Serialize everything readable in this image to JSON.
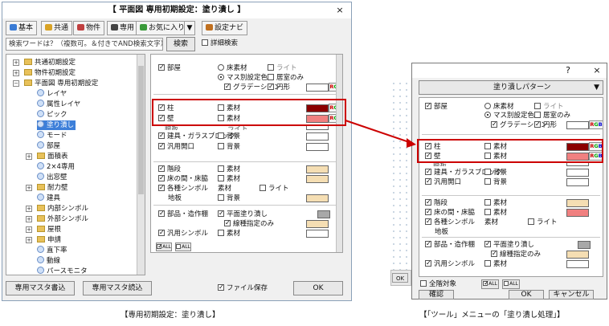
{
  "main": {
    "title": "【 平面図 専用初期設定：塗り潰し 】",
    "close_glyph": "×",
    "tabs": [
      "基本",
      "共通",
      "物件",
      "専用",
      "お気に入り",
      "▼"
    ],
    "tab_icon_colors": [
      "#3a7bd5",
      "#d9a326",
      "#c04040",
      "#444444",
      "#3a9a3a"
    ],
    "navi_label": "設定ナビ",
    "search_placeholder": "検索ワードは？（複数可。＆付きでAND検索文字）",
    "search_button": "検索",
    "detail_search_label": "詳細検索",
    "tree": [
      {
        "label": "共通初期設定",
        "kind": "folder",
        "expander": "+"
      },
      {
        "label": "物件初期設定",
        "kind": "folder",
        "expander": "+"
      },
      {
        "label": "平面図 専用初期設定",
        "kind": "folder",
        "expander": "−"
      },
      {
        "label": "レイヤ",
        "kind": "leaf"
      },
      {
        "label": "属性レイヤ",
        "kind": "leaf"
      },
      {
        "label": "ピック",
        "kind": "leaf"
      },
      {
        "label": "塗り潰し",
        "kind": "leaf",
        "selected": true
      },
      {
        "label": "モード",
        "kind": "leaf"
      },
      {
        "label": "部屋",
        "kind": "leaf"
      },
      {
        "label": "面積表",
        "kind": "folder",
        "expander": "+"
      },
      {
        "label": "2×4専用",
        "kind": "leaf"
      },
      {
        "label": "出窓壁",
        "kind": "leaf"
      },
      {
        "label": "耐力壁",
        "kind": "folder",
        "expander": "+"
      },
      {
        "label": "建具",
        "kind": "leaf"
      },
      {
        "label": "内部シンボル",
        "kind": "folder",
        "expander": "+"
      },
      {
        "label": "外部シンボル",
        "kind": "folder",
        "expander": "+"
      },
      {
        "label": "屋根",
        "kind": "folder",
        "expander": "+"
      },
      {
        "label": "申請",
        "kind": "folder",
        "expander": "+"
      },
      {
        "label": "直下率",
        "kind": "leaf"
      },
      {
        "label": "動線",
        "kind": "leaf"
      },
      {
        "label": "パースモニタ",
        "kind": "leaf"
      }
    ],
    "buttons": {
      "write": "専用マスタ書込",
      "read": "専用マスタ読込",
      "ok": "OK"
    },
    "file_save_label": "ファイル保存"
  },
  "panel": {
    "room": {
      "label": "部屋",
      "floor_material": "床素材",
      "light": "ライト",
      "mass_color": "マス別設定色",
      "living_only": "居室のみ",
      "gradation": "グラデーション",
      "circle": "円形"
    },
    "pillar": "柱",
    "wall": "壁",
    "material": "素材",
    "background": "背景",
    "cut_label": "腰板",
    "fitting": "建具・ガラスブロック",
    "general_opening": "汎用開口",
    "stairs": "階段",
    "floor_gap": "床の間・床脇",
    "symbols": "各種シンボル",
    "base_plate": "地板",
    "parts": "部品・造作棚",
    "plane_fill": "平面塗り潰し",
    "line_only": "線種指定のみ",
    "general_symbol": "汎用シンボル",
    "all_on": "ALL",
    "all_off": "ALL",
    "rgb": {
      "r": "R",
      "g": "G",
      "b": "B"
    }
  },
  "swatch_colors": {
    "white": "#ffffff",
    "pillar": "#8b0000",
    "wall": "#f08080",
    "beige": "#f5deb3",
    "gray": "#a8a8a8"
  },
  "tool": {
    "help_glyph": "?",
    "close_glyph": "×",
    "dropdown": "塗り潰しパターン",
    "dropdown_arrow": "▼",
    "all_target": "全階対象",
    "confirm": "確認",
    "ok": "OK",
    "cancel": "キャンセル"
  },
  "captions": {
    "left": "【専用初期設定：塗り潰し】",
    "right": "【「ツール」メニューの「塗り潰し処理」】"
  },
  "highlight_color": "#cc0000"
}
